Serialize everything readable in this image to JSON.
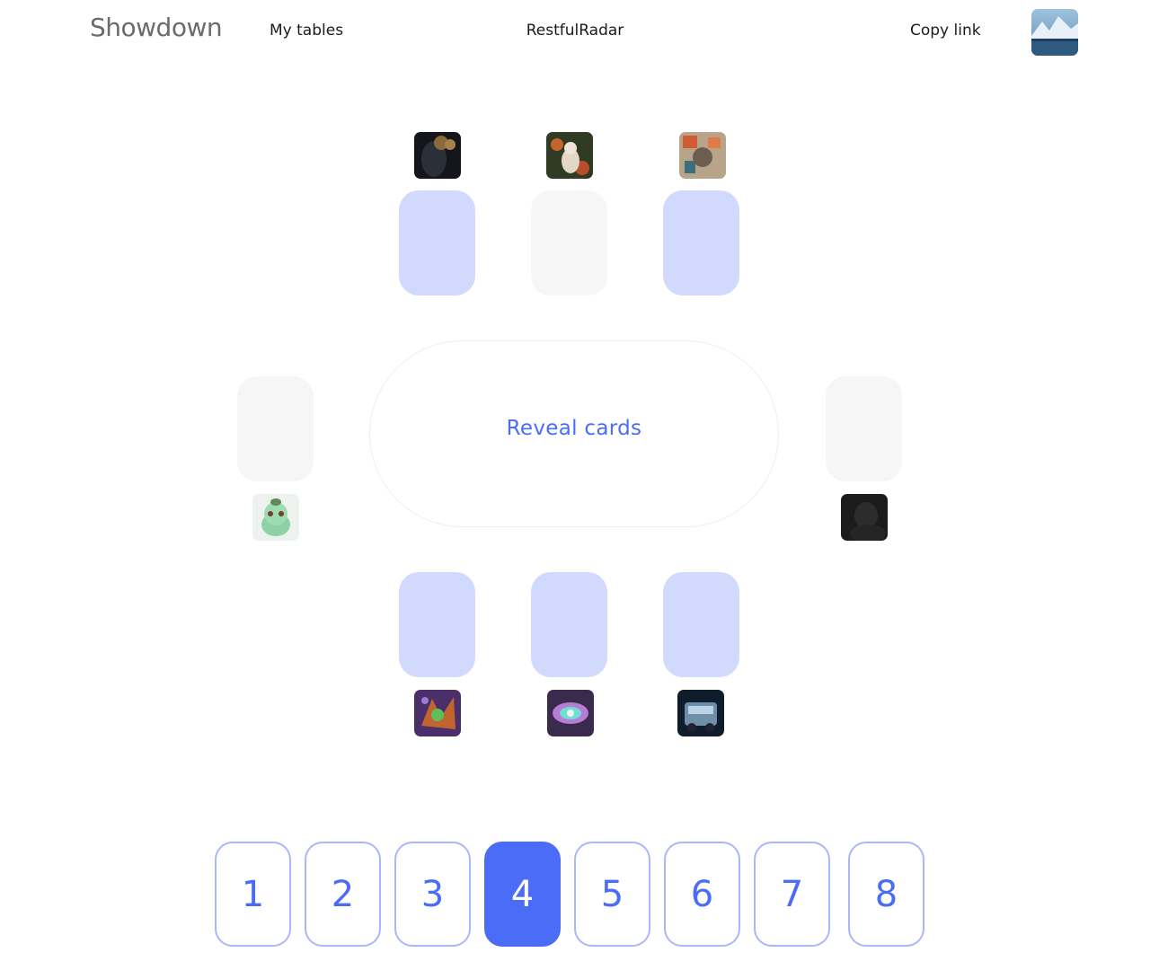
{
  "header": {
    "logo": "Showdown",
    "my_tables": "My tables",
    "table_name": "RestfulRadar",
    "copy_link": "Copy link"
  },
  "table": {
    "reveal_label": "Reveal cards"
  },
  "players": [
    {
      "seat": "top-1",
      "card": "voted"
    },
    {
      "seat": "top-2",
      "card": "empty"
    },
    {
      "seat": "top-3",
      "card": "voted"
    },
    {
      "seat": "left",
      "card": "empty"
    },
    {
      "seat": "right",
      "card": "empty"
    },
    {
      "seat": "bottom-1",
      "card": "voted"
    },
    {
      "seat": "bottom-2",
      "card": "voted"
    },
    {
      "seat": "bottom-3",
      "card": "voted"
    }
  ],
  "deck": {
    "cards": [
      "1",
      "2",
      "3",
      "4",
      "5",
      "6",
      "7",
      "8"
    ],
    "selected": "4"
  },
  "colors": {
    "accent": "#4a6cf7",
    "voted_card": "#d1d9fd",
    "empty_card": "#f6f6f6",
    "deck_border": "#a9b8fa"
  }
}
